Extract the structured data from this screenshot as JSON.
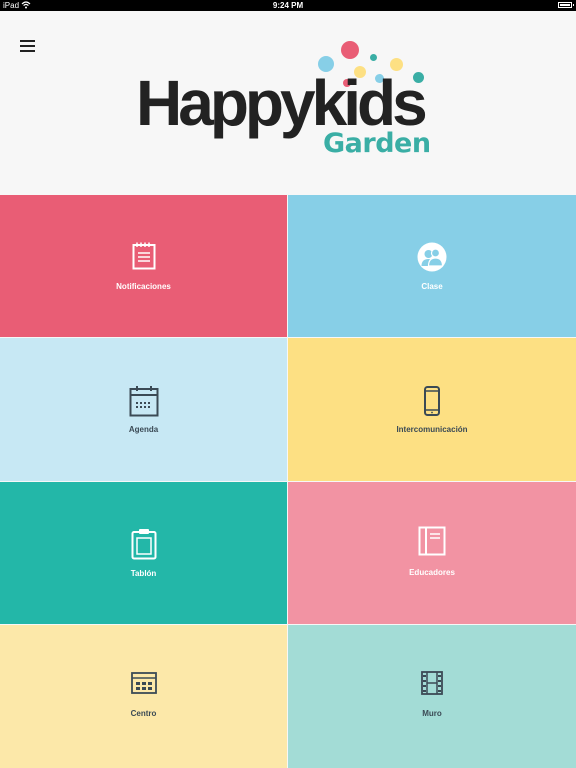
{
  "status_bar": {
    "device": "iPad",
    "time": "9:24 PM"
  },
  "app": {
    "logo_main": "Happykids",
    "logo_sub": "Garden"
  },
  "colors": {
    "red": "#e95d75",
    "sky": "#87cfe7",
    "lightblue": "#c7e8f4",
    "yellow": "#fde083",
    "teal": "#23b7a8",
    "pink": "#f293a3",
    "cream": "#fce8a9",
    "mint": "#a3dcd6",
    "logo_teal": "#3aaea5"
  },
  "tiles": [
    {
      "label": "Notificaciones",
      "icon": "notepad-icon"
    },
    {
      "label": "Clase",
      "icon": "users-icon"
    },
    {
      "label": "Agenda",
      "icon": "calendar-icon"
    },
    {
      "label": "Intercomunicación",
      "icon": "phone-icon"
    },
    {
      "label": "Tablón",
      "icon": "clipboard-icon"
    },
    {
      "label": "Educadores",
      "icon": "book-icon"
    },
    {
      "label": "Centro",
      "icon": "building-icon"
    },
    {
      "label": "Muro",
      "icon": "film-icon"
    }
  ]
}
